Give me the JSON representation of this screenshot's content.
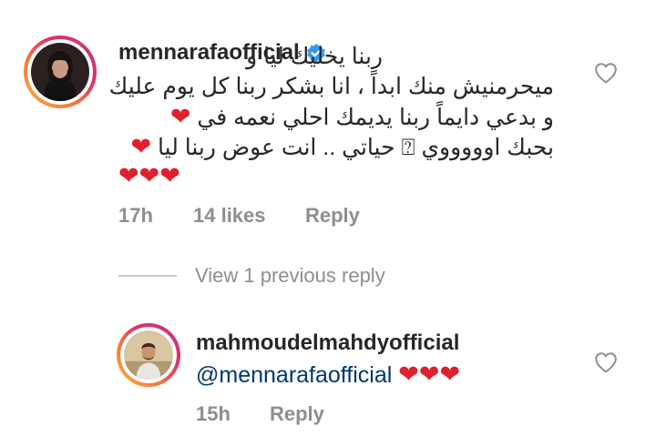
{
  "comment": {
    "username": "mennarafaofficial",
    "text_lines": [
      "ربنا يخليك ليا و",
      "ميحرمنيش منك ابداً ، انا بشكر ربنا كل يوم عليك",
      "و بدعي دايماً ربنا يديمك احلي نعمه في",
      "بحبك اوووووي ⍰ حياتي .. انت عوض ربنا ليا"
    ],
    "hearts": "❤",
    "time": "17h",
    "likes": "14 likes",
    "reply_label": "Reply"
  },
  "view_replies_label": "View 1 previous reply",
  "reply": {
    "username": "mahmoudelmahdyofficial",
    "mention": "@mennarafaofficial",
    "hearts": "❤❤❤",
    "time": "15h",
    "reply_label": "Reply"
  },
  "colors": {
    "verified": "#3897f0",
    "heart": "#e0202e",
    "link": "#00376b",
    "muted": "#8e8e8e"
  },
  "icons": {
    "like": "heart-outline-icon",
    "verified": "verified-badge-icon"
  }
}
